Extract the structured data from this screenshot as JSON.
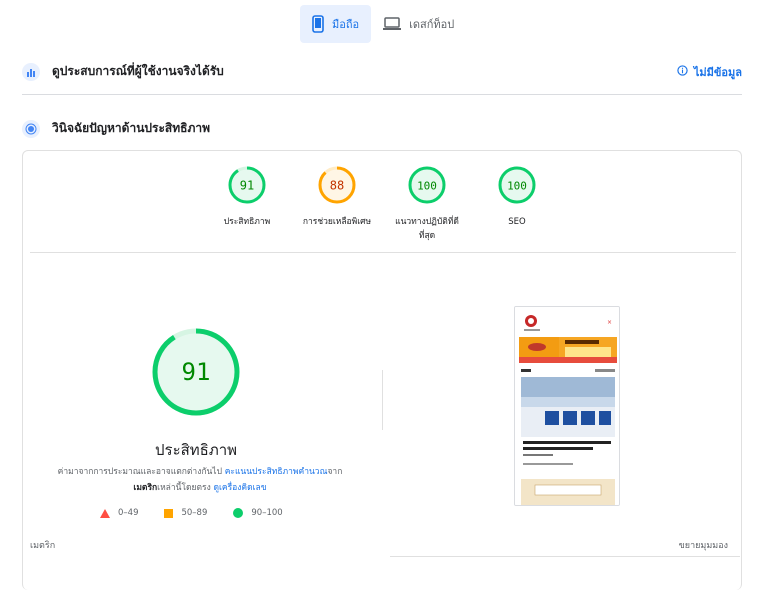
{
  "tabs": [
    {
      "label": "มือถือ",
      "icon": "mobile-icon",
      "active": true
    },
    {
      "label": "เดสก์ท็อป",
      "icon": "desktop-icon",
      "active": false
    }
  ],
  "field_data": {
    "title": "ดูประสบการณ์ที่ผู้ใช้งานจริงได้รับ",
    "no_data_label": "ไม่มีข้อมูล"
  },
  "diagnose": {
    "title": "วินิจฉัยปัญหาด้านประสิทธิภาพ"
  },
  "scores": [
    {
      "value": "91",
      "label": "ประสิทธิภาพ",
      "status": "pass"
    },
    {
      "value": "88",
      "label": "การช่วยเหลือพิเศษ",
      "status": "average"
    },
    {
      "value": "100",
      "label": "แนวทางปฏิบัติที่ดี\nที่สุด",
      "status": "pass"
    },
    {
      "value": "100",
      "label": "SEO",
      "status": "pass"
    }
  ],
  "main_score": {
    "value": "91",
    "label": "ประสิทธิภาพ"
  },
  "description": {
    "text1": "ค่ามาจากการประมาณและอาจแตกต่างกันไป ",
    "link1": "คะแนนประสิทธิภาพคำนวณ",
    "text2": "จาก",
    "bold": "เมตริก",
    "text3": "เหล่านี้โดยตรง ",
    "link2": "ดูเครื่องคิดเลข"
  },
  "legend": [
    {
      "range": "0–49",
      "color": "#ff4e42",
      "shape": "triangle"
    },
    {
      "range": "50–89",
      "color": "#ffa400",
      "shape": "square"
    },
    {
      "range": "90–100",
      "color": "#0cce6b",
      "shape": "circle"
    }
  ],
  "bottom": {
    "metrics_label": "เมตริก",
    "expand_label": "ขยายมุมมอง"
  },
  "colors": {
    "pass": "#0cce6b",
    "average": "#ffa400",
    "accent": "#1a73e8"
  }
}
